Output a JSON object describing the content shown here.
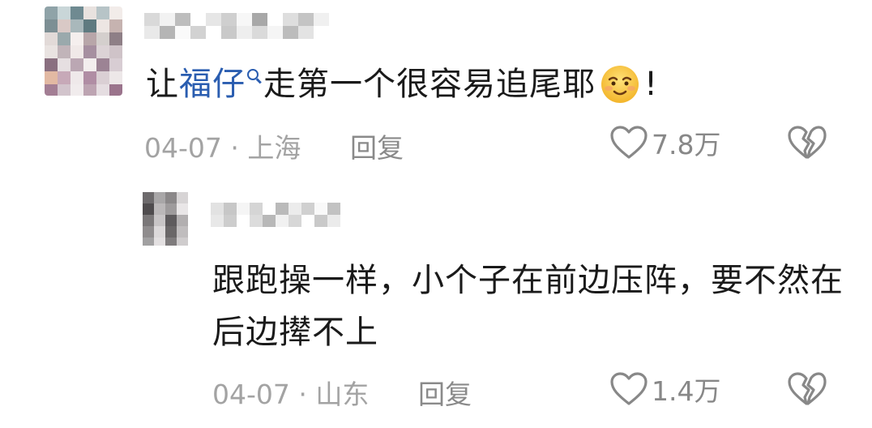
{
  "comments": [
    {
      "text_before": "让",
      "link": "福仔",
      "text_after": "走第一个很容易追尾耶",
      "emoji": "smiling-face-emoji",
      "text_end": "!",
      "date": "04-07",
      "separator": "·",
      "location": "上海",
      "reply_label": "回复",
      "likes": "7.8万"
    },
    {
      "text": "跟跑操一样，小个子在前边压阵，要不然在后边撵不上",
      "date": "04-07",
      "separator": "·",
      "location": "山东",
      "reply_label": "回复",
      "likes": "1.4万"
    }
  ],
  "icons": {
    "like": "heart-outline-icon",
    "dislike": "broken-heart-icon",
    "search": "search-icon"
  },
  "colors": {
    "text": "#1a1a1a",
    "link": "#2a5db0",
    "meta": "#a3a3a3",
    "icon": "#888888"
  }
}
